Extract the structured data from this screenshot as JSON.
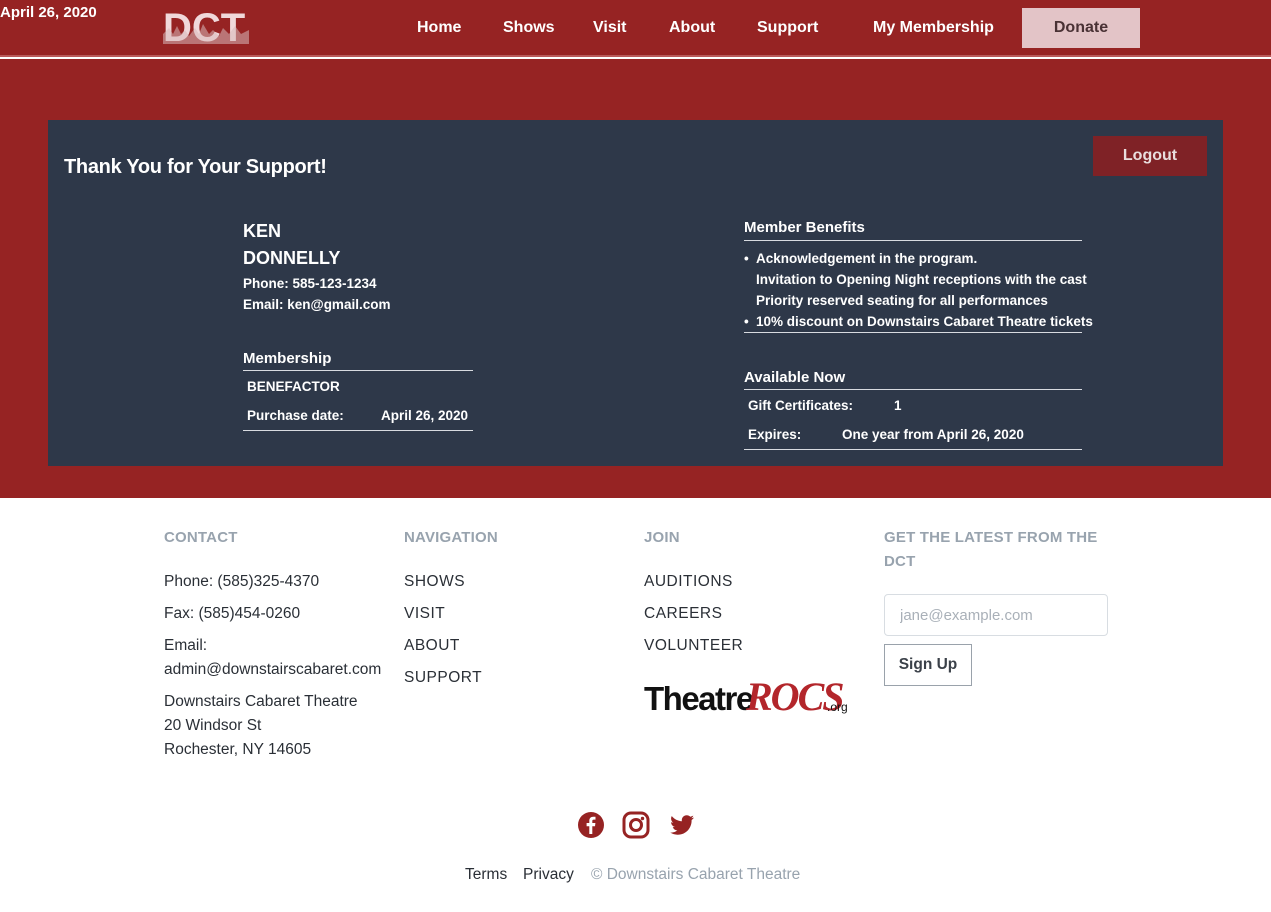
{
  "header": {
    "date": "April 26, 2020",
    "logo_text": "DCT",
    "nav": [
      "Home",
      "Shows",
      "Visit",
      "About",
      "Support",
      "My Membership"
    ],
    "donate_label": "Donate"
  },
  "panel": {
    "title": "Thank You for Your Support!",
    "logout_label": "Logout",
    "member": {
      "first_name": "KEN",
      "last_name": "DONNELLY",
      "phone": "Phone: 585-123-1234",
      "email": "Email: ken@gmail.com"
    },
    "membership": {
      "title": "Membership",
      "level": "BENEFACTOR",
      "purchase_label": "Purchase date:",
      "purchase_date": "April 26, 2020"
    },
    "benefits": {
      "title": "Member Benefits",
      "items": [
        "Acknowledgement in the program.",
        "Invitation to Opening Night receptions with the cast",
        "Priority reserved seating for all performances",
        "10% discount on Downstairs Cabaret Theatre tickets"
      ]
    },
    "available": {
      "title": "Available Now",
      "gift_label": "Gift Certificates:",
      "gift_value": "1",
      "expires_label": "Expires:",
      "expires_value": "One year from April 26, 2020"
    }
  },
  "footer": {
    "contact": {
      "heading": "CONTACT",
      "phone": "Phone: (585)325-4370",
      "fax": "Fax: (585)454-0260",
      "email_label": "Email:",
      "email": "admin@downstairscabaret.com",
      "address": [
        "Downstairs Cabaret Theatre",
        "20 Windsor St",
        "Rochester, NY 14605"
      ]
    },
    "navigation": {
      "heading": "NAVIGATION",
      "links": [
        "SHOWS",
        "VISIT",
        "ABOUT",
        "SUPPORT"
      ]
    },
    "join": {
      "heading": "JOIN",
      "links": [
        "AUDITIONS",
        "CAREERS",
        "VOLUNTEER"
      ],
      "logo_text_1": "Theatre",
      "logo_text_2": "ROCS",
      "logo_text_3": ".org"
    },
    "newsletter": {
      "heading_line1": "GET THE LATEST FROM THE",
      "heading_line2": "DCT",
      "placeholder": "jane@example.com",
      "signup_label": "Sign Up"
    },
    "social_icons": [
      "facebook-icon",
      "instagram-icon",
      "twitter-icon"
    ],
    "legal": {
      "terms": "Terms",
      "privacy": "Privacy",
      "copyright": "© Downstairs Cabaret Theatre"
    }
  },
  "colors": {
    "brand_red": "#962323",
    "panel_navy": "#2e3849",
    "donate_bg": "#e3c4c7",
    "logout_bg": "#7f2226"
  }
}
